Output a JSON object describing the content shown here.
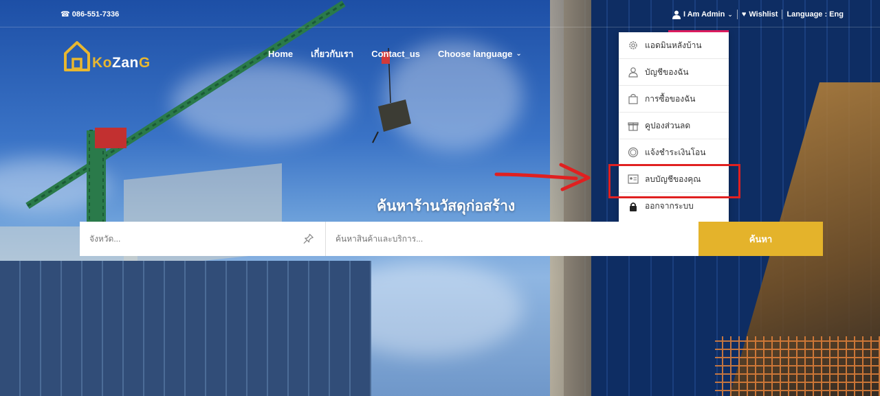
{
  "topbar": {
    "phone": "086-551-7336",
    "user_label": "I Am Admin",
    "wishlist_label": "Wishlist",
    "language_label": "Language : Eng"
  },
  "logo": {
    "part1": "Ko",
    "part2": "Zan",
    "part3": "G"
  },
  "nav": {
    "items": [
      {
        "label": "Home",
        "icon": ""
      },
      {
        "label": "เกี่ยวกับเรา",
        "icon": ""
      },
      {
        "label": "Contact_us",
        "icon": ""
      },
      {
        "label": "Choose language",
        "icon": "chevron-down-icon"
      }
    ]
  },
  "dropdown": {
    "items": [
      {
        "label": "แอดมินหลังบ้าน",
        "icon": "gear-icon"
      },
      {
        "label": "บัญชีของฉัน",
        "icon": "user-icon"
      },
      {
        "label": "การซื้อของฉัน",
        "icon": "shopping-bag-icon"
      },
      {
        "label": "คูปองส่วนลด",
        "icon": "gift-icon"
      },
      {
        "label": "แจ้งชำระเงินโอน",
        "icon": "coin-icon"
      },
      {
        "label": "ลบบัญชีของคุณ",
        "icon": "id-card-icon"
      },
      {
        "label": "ออกจากระบบ",
        "icon": "lock-icon"
      }
    ]
  },
  "search": {
    "title": "ค้นหาร้านวัสดุก่อสร้าง",
    "province_placeholder": "จังหวัด...",
    "query_placeholder": "ค้นหาสินค้าและบริการ...",
    "button_label": "ค้นหา"
  },
  "colors": {
    "accent": "#e4b32b",
    "highlight": "#e02020",
    "admin_underline": "#e91e63"
  }
}
